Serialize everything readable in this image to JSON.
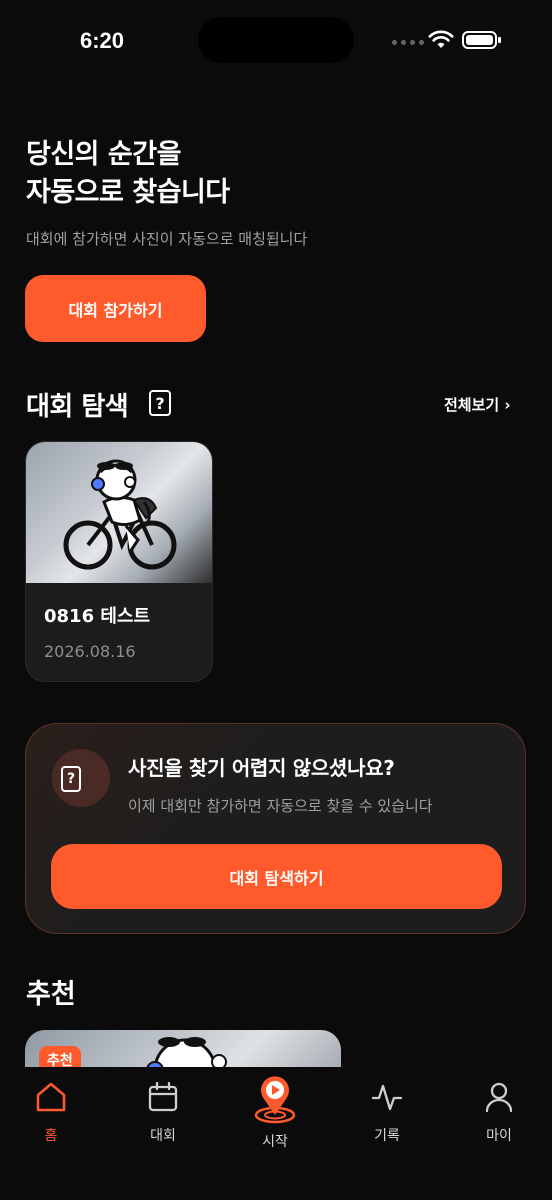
{
  "status_bar": {
    "time": "6:20"
  },
  "hero": {
    "title_line1": "당신의 순간을",
    "title_line2": "자동으로 찾습니다",
    "subtitle": "대회에 참가하면 사진이 자동으로 매칭됩니다",
    "join_button": "대회 참가하기"
  },
  "explore": {
    "title": "대회 탐색",
    "help_glyph": "?",
    "see_all": "전체보기 ›",
    "cards": [
      {
        "name": "0816 테스트",
        "date": "2026.08.16"
      }
    ]
  },
  "help_card": {
    "glyph": "?",
    "title": "사진을 찾기 어렵지 않으셨나요?",
    "description": "이제 대회만 참가하면 자동으로 찾을 수 있습니다",
    "button": "대회 탐색하기"
  },
  "recommend": {
    "title": "추천",
    "badge": "추천"
  },
  "tabbar": {
    "items": [
      {
        "label": "홈",
        "icon": "home-icon",
        "active": true
      },
      {
        "label": "대회",
        "icon": "calendar-icon",
        "active": false
      },
      {
        "label": "시작",
        "icon": "start-play-icon",
        "active": false
      },
      {
        "label": "기록",
        "icon": "activity-icon",
        "active": false
      },
      {
        "label": "마이",
        "icon": "user-icon",
        "active": false
      }
    ]
  },
  "colors": {
    "accent": "#ff5a2c",
    "background": "#0b0b0b",
    "card": "#1c1c1c"
  }
}
